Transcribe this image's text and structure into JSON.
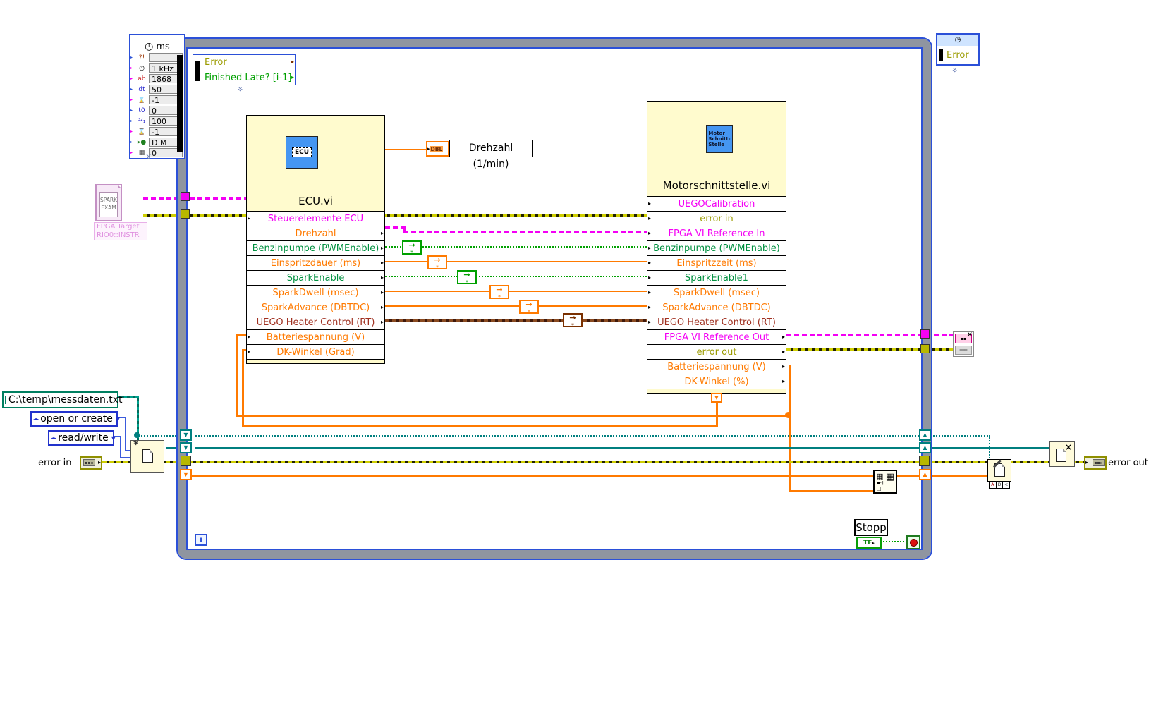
{
  "diagram": {
    "background": "#ffffff",
    "application": "LabVIEW block diagram"
  },
  "colors": {
    "structure_blue": "#2b50d8",
    "structure_gray": "#8f95a0",
    "node_yellow": "#fffbce",
    "icon_blue": "#4596f2",
    "wire_orange": "#ff7a00",
    "wire_green": "#00a000",
    "wire_magenta": "#f400f4",
    "wire_error_olive": "#cfcf00",
    "wire_teal": "#007f7f",
    "wire_brown": "#7a3000",
    "text_olive": "#9b9b00",
    "text_darkred": "#a03020"
  },
  "timing_node": {
    "unit": "ms",
    "rows": [
      {
        "icon": "error",
        "value": ""
      },
      {
        "icon": "clock",
        "value": "1 kHz"
      },
      {
        "icon": "abc",
        "value": "1868"
      },
      {
        "icon": "dt",
        "value": "50"
      },
      {
        "icon": "hourglass-warning",
        "value": "-1"
      },
      {
        "icon": "t0",
        "value": "0"
      },
      {
        "icon": "321",
        "value": "100"
      },
      {
        "icon": "hourglass-error",
        "value": "-1"
      },
      {
        "icon": "cursor",
        "value": "D M"
      },
      {
        "icon": "chip",
        "value": "0"
      }
    ]
  },
  "loop_input_node": {
    "rows": [
      {
        "label": "Error",
        "color": "#9b9b00"
      },
      {
        "label": "Finished Late? [i-1]",
        "color": "#00a000"
      }
    ]
  },
  "loop_output_node": {
    "label": "Error",
    "color": "#9b9b00"
  },
  "fpga_target_constant": {
    "icon_lines": [
      "SPARK",
      "EXAM"
    ],
    "caption_lines": [
      "FPGA Target",
      "RIO0::INSTR"
    ]
  },
  "ecu_vi": {
    "title": "ECU.vi",
    "icon_text": "ECU",
    "terminals": [
      {
        "label": "Steuerelemente ECU",
        "color": "#f400f4"
      },
      {
        "label": "Drehzahl",
        "color": "#ff7a00"
      },
      {
        "label": "Benzinpumpe (PWMEnable)",
        "color": "#009040"
      },
      {
        "label": "Einspritzdauer (ms)",
        "color": "#ff7a00"
      },
      {
        "label": "SparkEnable",
        "color": "#009040"
      },
      {
        "label": "SparkDwell (msec)",
        "color": "#ff7a00"
      },
      {
        "label": "SparkAdvance (DBTDC)",
        "color": "#ff7a00"
      },
      {
        "label": "UEGO Heater Control (RT)",
        "color": "#a03020"
      },
      {
        "label": "Batteriespannung (V)",
        "color": "#ff7a00"
      },
      {
        "label": "DK-Winkel (Grad)",
        "color": "#ff7a00"
      }
    ]
  },
  "motor_vi": {
    "title": "Motorschnittstelle.vi",
    "icon_lines": [
      "Motor",
      "Schnitt-",
      "Stelle"
    ],
    "terminals": [
      {
        "label": "UEGOCalibration",
        "color": "#f400f4"
      },
      {
        "label": "error in",
        "color": "#9b9b00"
      },
      {
        "label": "FPGA VI Reference In",
        "color": "#f400f4"
      },
      {
        "label": "Benzinpumpe (PWMEnable)",
        "color": "#009040"
      },
      {
        "label": "Einspritzzeit (ms)",
        "color": "#ff7a00"
      },
      {
        "label": "SparkEnable1",
        "color": "#009040"
      },
      {
        "label": "SparkDwell (msec)",
        "color": "#ff7a00"
      },
      {
        "label": "SparkAdvance (DBTDC)",
        "color": "#ff7a00"
      },
      {
        "label": "UEGO Heater Control (RT)",
        "color": "#a03020"
      },
      {
        "label": "FPGA VI Reference Out",
        "color": "#f400f4"
      },
      {
        "label": "error out",
        "color": "#9b9b00"
      },
      {
        "label": "Batteriespannung (V)",
        "color": "#ff7a00"
      },
      {
        "label": "DK-Winkel (%)",
        "color": "#ff7a00"
      }
    ]
  },
  "drehzahl_indicator": {
    "datatype": "DBL",
    "label": "Drehzahl (1/min)"
  },
  "file_path_constant": {
    "value": "C:\\temp\\messdaten.txt"
  },
  "open_mode_enum": {
    "value": "open or create"
  },
  "access_mode_enum": {
    "value": "read/write"
  },
  "error_in": {
    "label": "error in"
  },
  "error_out": {
    "label": "error out"
  },
  "stop_control": {
    "label": "Stopp",
    "terminal": "TF"
  },
  "iteration_terminal": {
    "label": "i"
  }
}
